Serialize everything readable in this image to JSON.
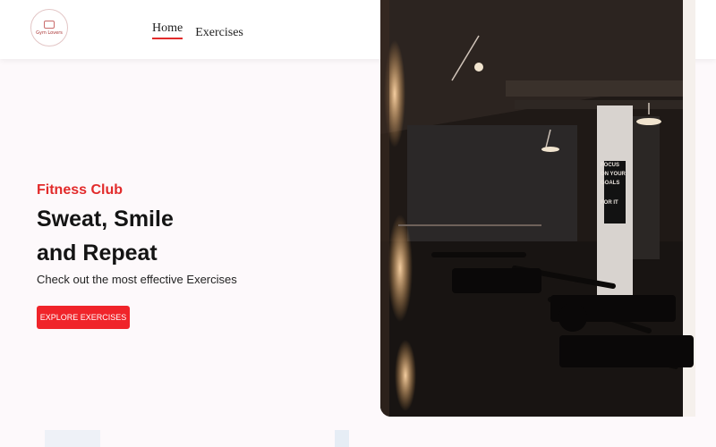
{
  "header": {
    "logo_text": "Gym Lovers",
    "nav": [
      {
        "label": "Home",
        "active": true
      },
      {
        "label": "Exercises",
        "active": false
      }
    ]
  },
  "hero": {
    "eyebrow": "Fitness Club",
    "headline_line1": "Sweat, Smile",
    "headline_line2": "and Repeat",
    "subtext": "Check out the most effective Exercises",
    "cta_label": "EXPLORE EXERCISES",
    "poster_text": [
      "FOCUS",
      "ON YOUR",
      "GOALS",
      "FOR IT"
    ]
  },
  "colors": {
    "accent": "#e22b2b",
    "button": "#f0242a",
    "background": "#fdf9fb"
  }
}
